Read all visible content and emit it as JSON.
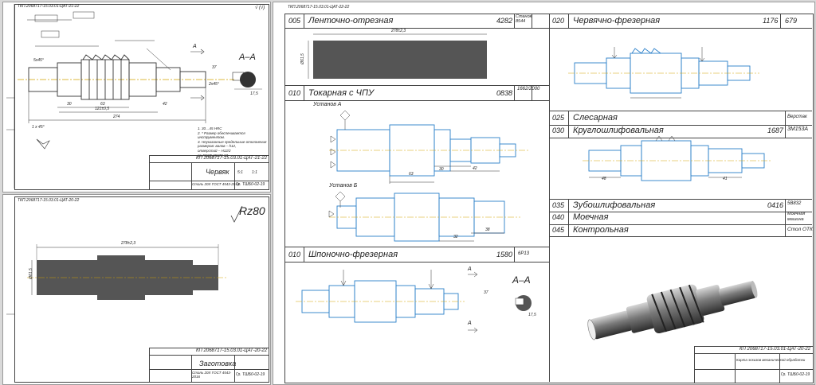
{
  "sheet1": {
    "stamp": "ТКП.2068717-15.03.01-ЦАТ-21-22",
    "section_label": "А–А",
    "section_arrow": "А",
    "designation": "КП 2068717-15.03.01-ЦАТ-21-22",
    "part_name": "Червяк",
    "material": "Сталь 20Х ГОСТ 4543-2016",
    "group": "Гр. ТШБ0-02-19",
    "scale": "5:1",
    "mass": "1:1",
    "notes": [
      "1. 30…45 HRC",
      "2. * Размер обеспечивается инструментом.",
      "3. Неуказанные предельные отклонения",
      "размеров: валов – h12,",
      "отверстий – H12/2",
      "по ГОСТ 25670-83"
    ],
    "roughness": "√ (√)",
    "dims": {
      "len_total": "274",
      "len_a": "30",
      "len_b": "63",
      "len_c": "121±0,5",
      "len_d": "42",
      "len_e": "37",
      "len_f": "17,5",
      "angle1": "1 x 45°",
      "angle2": "5x45°",
      "chamfer": "2x45°"
    }
  },
  "sheet2": {
    "stamp": "ТКП.2068717-15.03.01-ЦАТ-20-22",
    "roughness": "Rz80",
    "dim_len": "278±2,3",
    "dim_dia": "Ø61,5",
    "designation": "КП 2068717-15.03.01-ЦАТ-20-22",
    "part_name": "Заготовка",
    "material": "Сталь 20Х ГОСТ 4543-2016",
    "group": "Гр. ТШБ0-02-19"
  },
  "sheet3": {
    "stamp": "ТКП.2068717-15.03.01-ЦАТ-22-22",
    "ops": [
      {
        "num": "005",
        "name": "Ленточно-отрезная",
        "code": "4282",
        "machine": "Станок 8544"
      },
      {
        "num": "010",
        "name": "Токарная с ЧПУ",
        "code": "0838",
        "machine": "1662/2000"
      },
      {
        "num": "010",
        "name": "Шпоночно-фрезерная",
        "code": "1580",
        "machine": "6Р13"
      },
      {
        "num": "020",
        "name": "Червячно-фрезерная",
        "code": "1176",
        "machine": "679"
      },
      {
        "num": "025",
        "name": "Слесарная",
        "code": "",
        "machine": "Верстак"
      },
      {
        "num": "030",
        "name": "Круглошлифовальная",
        "code": "1687",
        "machine": "3М153А"
      },
      {
        "num": "035",
        "name": "Зубошлифовальная",
        "code": "0416",
        "machine": "5В832"
      },
      {
        "num": "040",
        "name": "Моечная",
        "code": "",
        "machine": "Моечная машина"
      },
      {
        "num": "045",
        "name": "Контрольная",
        "code": "",
        "machine": "Стол ОТК"
      }
    ],
    "setup_a": "Установ А",
    "setup_b": "Установ Б",
    "section_label": "А–А",
    "section_arrow": "А",
    "designation": "КП 2068717-15.03.01-ЦАТ-20-22",
    "part_name": "Карта эскизов механической обработки",
    "group": "Гр. ТШБ0-02-19",
    "dims": {
      "blank_len": "278±2,3",
      "blank_dia": "Ø61,5",
      "d63": "63",
      "d30": "30",
      "d42": "42",
      "d38": "38",
      "d32": "32",
      "d48": "48",
      "d41": "41",
      "d37": "37",
      "d175": "17,5"
    }
  },
  "colors": {
    "drawing": "#2a7fc9",
    "axis": "#d4a300",
    "paper": "#ffffff",
    "frame": "#444444",
    "blank": "#555555"
  }
}
